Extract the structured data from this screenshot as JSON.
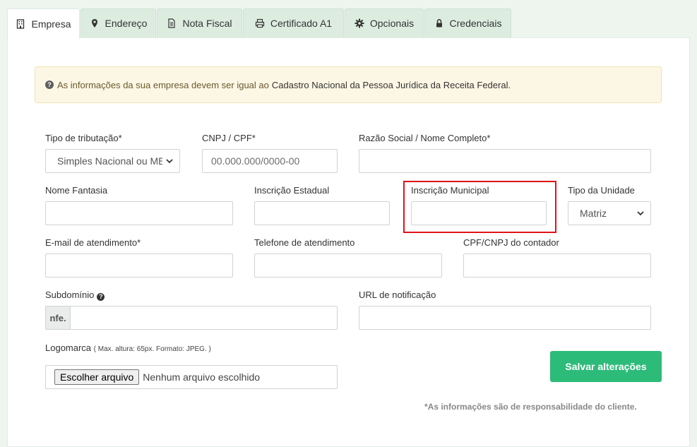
{
  "tabs": [
    {
      "label": "Empresa",
      "icon": "building-icon",
      "active": true
    },
    {
      "label": "Endereço",
      "icon": "map-marker-icon",
      "active": false
    },
    {
      "label": "Nota Fiscal",
      "icon": "document-icon",
      "active": false
    },
    {
      "label": "Certificado A1",
      "icon": "printer-icon",
      "active": false
    },
    {
      "label": "Opcionais",
      "icon": "gear-icon",
      "active": false
    },
    {
      "label": "Credenciais",
      "icon": "lock-icon",
      "active": false
    }
  ],
  "alert": {
    "text_part1": "As informações da sua empresa devem ser igual ao",
    "text_part2": "Cadastro Nacional da Pessoa Jurídica da Receita Federal."
  },
  "form": {
    "tipo_tributacao": {
      "label": "Tipo de tributação*",
      "value": "Simples Nacional ou MEI"
    },
    "cnpj_cpf": {
      "label": "CNPJ / CPF*",
      "placeholder": "00.000.000/0000-00"
    },
    "razao_social": {
      "label": "Razão Social / Nome Completo*",
      "value": ""
    },
    "nome_fantasia": {
      "label": "Nome Fantasia",
      "value": ""
    },
    "inscricao_estadual": {
      "label": "Inscrição Estadual",
      "value": ""
    },
    "inscricao_municipal": {
      "label": "Inscrição Municipal",
      "value": ""
    },
    "tipo_unidade": {
      "label": "Tipo da Unidade",
      "value": "Matriz"
    },
    "email_atendimento": {
      "label": "E-mail de atendimento*",
      "value": ""
    },
    "telefone_atendimento": {
      "label": "Telefone de atendimento",
      "value": ""
    },
    "cpf_cnpj_contador": {
      "label": "CPF/CNPJ do contador",
      "value": ""
    },
    "subdominio": {
      "label": "Subdomínio",
      "prefix": "nfe.",
      "value": ""
    },
    "url_notificacao": {
      "label": "URL de notificação",
      "value": ""
    },
    "logomarca": {
      "label": "Logomarca",
      "note": "( Max. altura: 65px. Formato: JPEG. )",
      "button": "Escolher arquivo",
      "status": "Nenhum arquivo escolhido"
    }
  },
  "save_button": "Salvar alterações",
  "footer_note": "*As informações são de responsabilidade do cliente.",
  "colors": {
    "accent": "#2dbb7a",
    "highlight": "#e0131a",
    "alert_bg": "#fcf6e4"
  }
}
